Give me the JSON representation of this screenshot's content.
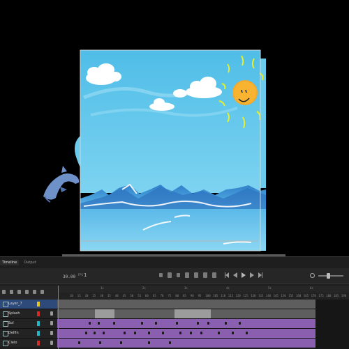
{
  "timeline": {
    "tabs": [
      "Timeline",
      "Output"
    ],
    "fps": "30.00",
    "fps_unit": "FPS",
    "current_frame": "1",
    "ruler_top": [
      "1s",
      "2s",
      "3s",
      "4s",
      "5s",
      "6s"
    ],
    "ruler_numbers": [
      "10",
      "15",
      "20",
      "25",
      "30",
      "35",
      "40",
      "45",
      "50",
      "55",
      "60",
      "65",
      "70",
      "75",
      "80",
      "85",
      "90",
      "95",
      "100",
      "105",
      "110",
      "115",
      "120",
      "125",
      "130",
      "135",
      "140",
      "145",
      "150",
      "155",
      "160",
      "165",
      "170",
      "175",
      "180",
      "185",
      "190"
    ],
    "layers": [
      {
        "name": "Layer_7",
        "color": "#e8c51f",
        "selected": true
      },
      {
        "name": "Splash",
        "color": "#d92a2a",
        "selected": false
      },
      {
        "name": "Sol",
        "color": "#1fb8c9",
        "selected": false
      },
      {
        "name": "Delfin",
        "color": "#1fb8c9",
        "selected": false
      },
      {
        "name": "Cielo",
        "color": "#d92a2a",
        "selected": false
      }
    ]
  },
  "colors": {
    "sky": "#5dc6ec",
    "sea": "#3a9ad8",
    "sun": "#f6a82a",
    "purple_track": "#8a5fb0",
    "playhead": "#3e8cf0"
  }
}
